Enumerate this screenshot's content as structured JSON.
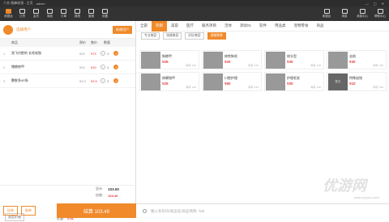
{
  "titlebar": {
    "app_title": "六合 随峰收银 - 主页",
    "account": "admin",
    "minimize": "—",
    "restore": "▢",
    "close": "✕"
  },
  "toolbar": {
    "left_tools": [
      {
        "label": "收银台",
        "icon": "register-icon"
      },
      {
        "label": "订货",
        "icon": "cart-icon"
      },
      {
        "label": "会员",
        "icon": "member-icon"
      },
      {
        "label": "商品",
        "icon": "goods-icon"
      },
      {
        "label": "订单",
        "icon": "order-icon"
      },
      {
        "label": "报表",
        "icon": "report-icon"
      },
      {
        "label": "营销",
        "icon": "marketing-icon"
      },
      {
        "label": "设置",
        "icon": "settings-icon"
      }
    ],
    "right_tools": [
      {
        "label": "收银台",
        "icon": "cashier-icon"
      },
      {
        "label": "消息",
        "icon": "bell-icon"
      },
      {
        "label": "消息中心",
        "icon": "message-icon"
      },
      {
        "label": "帮助中心",
        "icon": "help-icon"
      }
    ]
  },
  "user": {
    "select_label": "选择用户",
    "add_label": "新建用户"
  },
  "cart_table": {
    "headers": [
      "商品",
      "原价",
      "售价",
      "数量"
    ],
    "rows": [
      {
        "idx": "1",
        "name": "泡飞内腔的 长毛轮胎",
        "orig": "¥25",
        "price": "¥75",
        "qty": "1"
      },
      {
        "idx": "2",
        "name": "猪粮修甲",
        "orig": "¥30",
        "price": "¥30",
        "qty": "1"
      },
      {
        "idx": "3",
        "name": "鹏鲜多40场",
        "orig": "¥3.5",
        "price": "¥3.5",
        "qty": "1"
      }
    ]
  },
  "summary": {
    "promo_button": "选定价格",
    "total_label": "总计:",
    "total_value": "103.50",
    "receivable_label": "应收:",
    "receivable_value": "103.49",
    "discount_label": "优惠:",
    "discount_value": "0.01"
  },
  "bottom": {
    "hold_label": "挂单",
    "takeout_label": "取单",
    "checkout_label": "结算 103.49"
  },
  "categories": {
    "tabs": [
      "全部",
      "热销",
      "美容",
      "医疗",
      "服务项目",
      "活体",
      "测试01",
      "软件",
      "用品类",
      "宠物零食",
      "商品"
    ],
    "active_tab": 1,
    "subtabs": [
      "专业美容",
      "快捷美容",
      "好好美容",
      "宠物寄养"
    ],
    "active_subtab": 3
  },
  "products": [
    {
      "name": "狗粮甲",
      "price": "¥25",
      "stock": "库存: 100",
      "col": 0,
      "row": 0
    },
    {
      "name": "修剪狗毛",
      "price": "¥20",
      "stock": "库存: 100",
      "col": 1,
      "row": 0
    },
    {
      "name": "修头型",
      "price": "¥30",
      "stock": "库存: 100",
      "col": 2,
      "row": 0
    },
    {
      "name": "去结",
      "price": "¥30",
      "stock": "库存: 100",
      "col": 3,
      "row": 0
    },
    {
      "name": "修脚指甲",
      "price": "¥25",
      "stock": "库存: 100",
      "col": 0,
      "row": 1
    },
    {
      "name": "口腔护理",
      "price": "¥60",
      "stock": "库存: 100",
      "col": 1,
      "row": 1
    },
    {
      "name": "护理毛发",
      "price": "¥30",
      "stock": "库存: 100",
      "col": 2,
      "row": 1
    },
    {
      "name": "特殊加钱",
      "price": "¥10",
      "stock": "库存: 100",
      "col": 3,
      "row": 1,
      "no_image": "暂无"
    }
  ],
  "search": {
    "placeholder": "输入条形码/商品名/商品简称: Tab"
  },
  "watermark": {
    "text": "优游网",
    "url": "www.yoyou.com"
  }
}
